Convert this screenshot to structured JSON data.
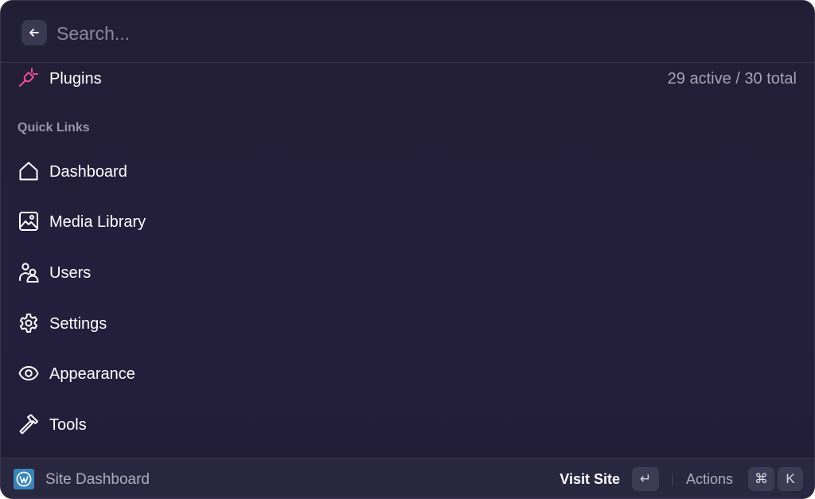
{
  "search": {
    "placeholder": "Search...",
    "value": "",
    "back_icon": "arrow-left-icon"
  },
  "plugins": {
    "label": "Plugins",
    "count": "29 active / 30 total",
    "icon": "plug-icon",
    "icon_color": "#e94d9c"
  },
  "quick_links": {
    "title": "Quick Links",
    "items": [
      {
        "label": "Dashboard",
        "icon": "home-icon"
      },
      {
        "label": "Media Library",
        "icon": "image-icon"
      },
      {
        "label": "Users",
        "icon": "users-icon"
      },
      {
        "label": "Settings",
        "icon": "gear-icon"
      },
      {
        "label": "Appearance",
        "icon": "eye-icon"
      },
      {
        "label": "Tools",
        "icon": "hammer-icon"
      }
    ]
  },
  "footer": {
    "site_label": "Site Dashboard",
    "site_icon": "wordpress-logo-icon",
    "visit_label": "Visit Site",
    "enter_key": "↵",
    "actions_label": "Actions",
    "cmd_key": "⌘",
    "k_key": "K"
  },
  "colors": {
    "background": "#231f39",
    "accent": "#e94d9c",
    "muted_text": "#a6a4b4",
    "wordpress_blue": "#3a85b8"
  }
}
